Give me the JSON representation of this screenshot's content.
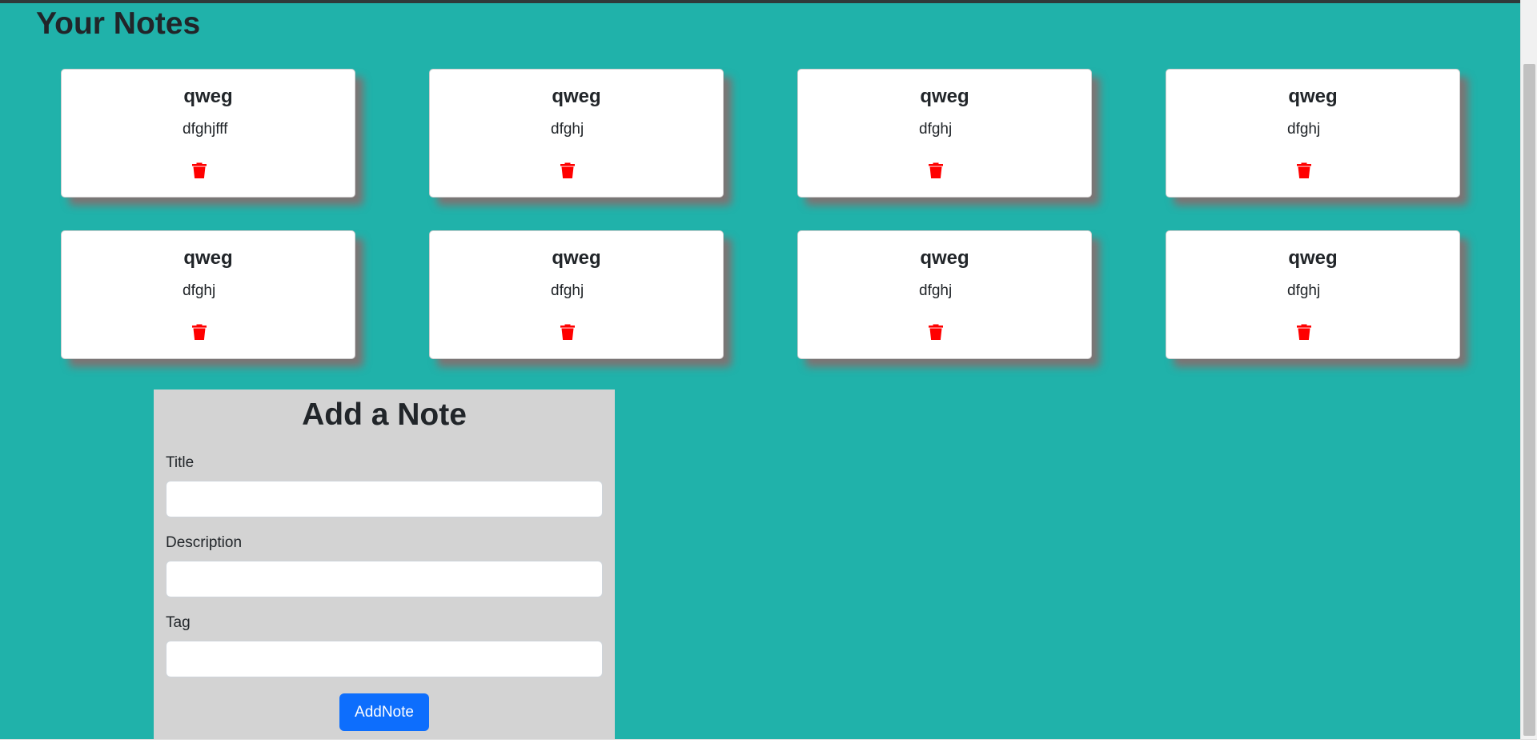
{
  "page": {
    "title": "Your Notes"
  },
  "notes": [
    {
      "title": "qweg",
      "description": "dfghjfff",
      "delete_icon": "trash-icon"
    },
    {
      "title": "qweg",
      "description": "dfghj",
      "delete_icon": "trash-icon"
    },
    {
      "title": "qweg",
      "description": "dfghj",
      "delete_icon": "trash-icon"
    },
    {
      "title": "qweg",
      "description": "dfghj",
      "delete_icon": "trash-icon"
    },
    {
      "title": "qweg",
      "description": "dfghj",
      "delete_icon": "trash-icon"
    },
    {
      "title": "qweg",
      "description": "dfghj",
      "delete_icon": "trash-icon"
    },
    {
      "title": "qweg",
      "description": "dfghj",
      "delete_icon": "trash-icon"
    },
    {
      "title": "qweg",
      "description": "dfghj",
      "delete_icon": "trash-icon"
    }
  ],
  "add_note": {
    "heading": "Add a Note",
    "title_label": "Title",
    "title_value": "",
    "description_label": "Description",
    "description_value": "",
    "tag_label": "Tag",
    "tag_value": "",
    "submit_label": "AddNote"
  },
  "colors": {
    "background": "#20b2aa",
    "card": "#ffffff",
    "panel": "#d3d3d3",
    "delete_icon": "#ff0000",
    "button": "#0d6efd"
  }
}
